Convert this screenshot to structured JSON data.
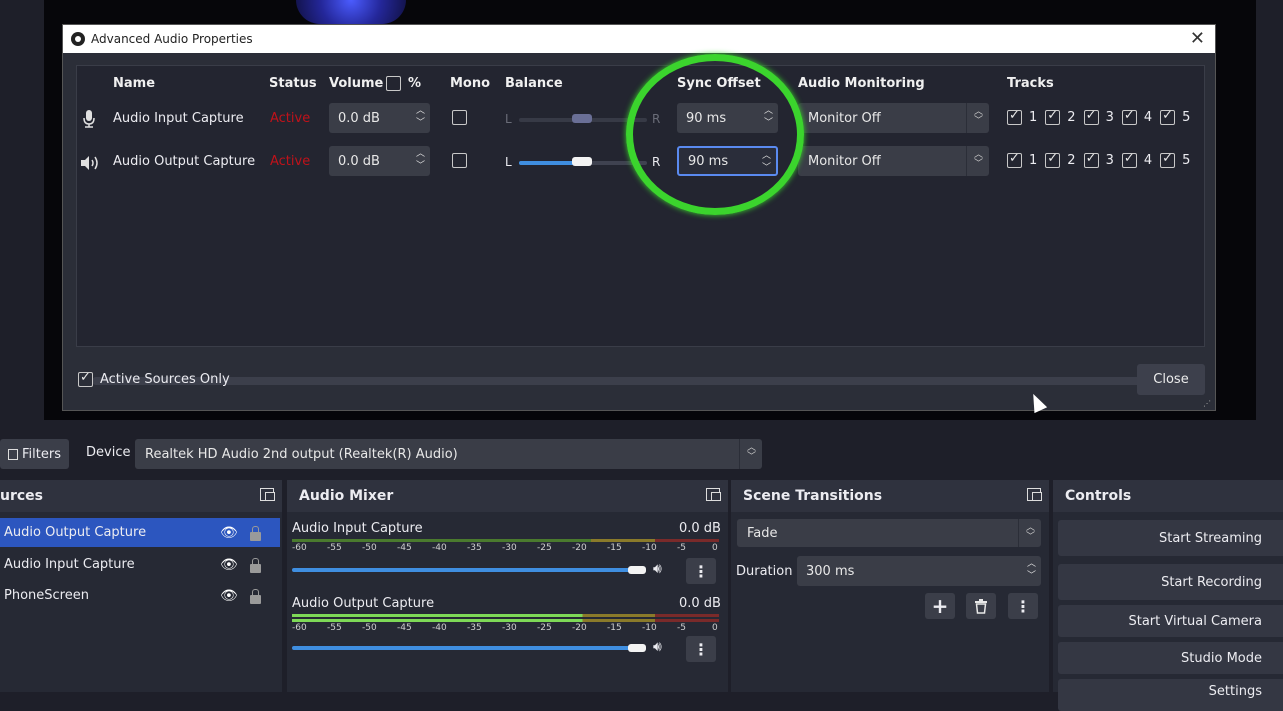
{
  "dialog": {
    "title": "Advanced Audio Properties",
    "columns": {
      "name": "Name",
      "status": "Status",
      "volume": "Volume",
      "volume_pct": "%",
      "mono": "Mono",
      "balance": "Balance",
      "sync_offset": "Sync Offset",
      "audio_monitoring": "Audio Monitoring",
      "tracks": "Tracks"
    },
    "rows": [
      {
        "name": "Audio Input Capture",
        "icon": "microphone-icon",
        "status": "Active",
        "volume": "0.0 dB",
        "mono": false,
        "balance_left": "L",
        "balance_right": "R",
        "balance_value": 0.5,
        "balance_enabled": false,
        "sync_offset": "90 ms",
        "monitoring": "Monitor Off",
        "tracks": [
          "1",
          "2",
          "3",
          "4",
          "5"
        ]
      },
      {
        "name": "Audio Output Capture",
        "icon": "speaker-icon",
        "status": "Active",
        "volume": "0.0 dB",
        "mono": false,
        "balance_left": "L",
        "balance_right": "R",
        "balance_value": 0.5,
        "balance_enabled": true,
        "sync_offset": "90 ms",
        "monitoring": "Monitor Off",
        "tracks": [
          "1",
          "2",
          "3",
          "4",
          "5"
        ]
      }
    ],
    "active_sources_only": "Active Sources Only",
    "close_label": "Close"
  },
  "device_bar": {
    "filters_label": "Filters",
    "device_label": "Device",
    "device_value": "Realtek HD Audio 2nd output (Realtek(R) Audio)"
  },
  "sources": {
    "title": "urces",
    "items": [
      "Audio Output Capture",
      "Audio Input Capture",
      "PhoneScreen"
    ]
  },
  "mixer": {
    "title": "Audio Mixer",
    "channels": [
      {
        "name": "Audio Input Capture",
        "level": "0.0 dB"
      },
      {
        "name": "Audio Output Capture",
        "level": "0.0 dB"
      }
    ],
    "ticks": [
      "-60",
      "-55",
      "-50",
      "-45",
      "-40",
      "-35",
      "-30",
      "-25",
      "-20",
      "-15",
      "-10",
      "-5",
      "0"
    ]
  },
  "transitions": {
    "title": "Scene Transitions",
    "transition": "Fade",
    "duration_label": "Duration",
    "duration_value": "300 ms"
  },
  "controls": {
    "title": "Controls",
    "buttons": [
      "Start Streaming",
      "Start Recording",
      "Start Virtual Camera",
      "Studio Mode",
      "Settings"
    ]
  },
  "colors": {
    "accent": "#2c56bf",
    "active_status": "#c0121a",
    "highlight_circle": "#3bd42d"
  }
}
